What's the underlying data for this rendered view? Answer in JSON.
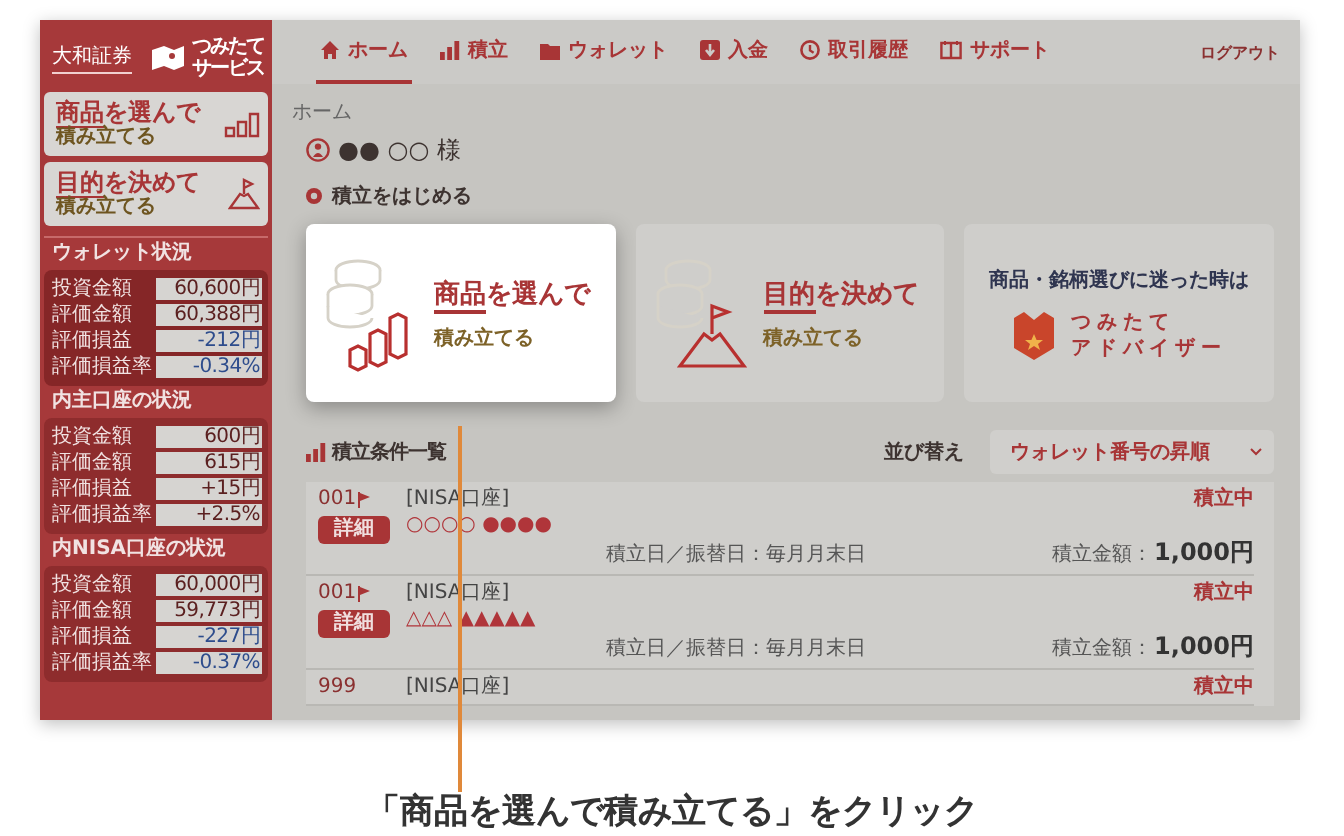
{
  "sidebar": {
    "brand": "大和証券",
    "service_logo": [
      "つみたて",
      "サービス"
    ],
    "shortcuts": [
      {
        "kind": "chart",
        "title_em": "商品",
        "title_rest": "を選んで",
        "subtitle": "積み立てる"
      },
      {
        "kind": "flag",
        "title_em": "目的",
        "title_rest": "を決めて",
        "subtitle": "積み立てる"
      }
    ],
    "summaries": [
      {
        "heading": "ウォレット状況",
        "rows": [
          {
            "label": "投資金額",
            "value": "60,600円",
            "negative": false
          },
          {
            "label": "評価金額",
            "value": "60,388円",
            "negative": false
          },
          {
            "label": "評価損益",
            "value": "-212円",
            "negative": true
          },
          {
            "label": "評価損益率",
            "value": "-0.34%",
            "negative": true
          }
        ]
      },
      {
        "heading": "内主口座の状況",
        "rows": [
          {
            "label": "投資金額",
            "value": "600円",
            "negative": false
          },
          {
            "label": "評価金額",
            "value": "615円",
            "negative": false
          },
          {
            "label": "評価損益",
            "value": "+15円",
            "negative": false
          },
          {
            "label": "評価損益率",
            "value": "+2.5%",
            "negative": false
          }
        ]
      },
      {
        "heading": "内NISA口座の状況",
        "rows": [
          {
            "label": "投資金額",
            "value": "60,000円",
            "negative": false
          },
          {
            "label": "評価金額",
            "value": "59,773円",
            "negative": false
          },
          {
            "label": "評価損益",
            "value": "-227円",
            "negative": true
          },
          {
            "label": "評価損益率",
            "value": "-0.37%",
            "negative": true
          }
        ]
      }
    ]
  },
  "nav": {
    "items": [
      {
        "label": "ホーム",
        "selected": true
      },
      {
        "label": "積立",
        "selected": false
      },
      {
        "label": "ウォレット",
        "selected": false
      },
      {
        "label": "入金",
        "selected": false
      },
      {
        "label": "取引履歴",
        "selected": false
      },
      {
        "label": "サポート",
        "selected": false
      }
    ],
    "logout": "ログアウト"
  },
  "breadcrumb": "ホーム",
  "user_name": "●● ○○ 様",
  "start": {
    "heading": "積立をはじめる",
    "cards": [
      {
        "kind": "product",
        "title_em": "商品",
        "title_rest": "を選んで",
        "subtitle": "積み立てる",
        "highlighted": true
      },
      {
        "kind": "goal",
        "title_em": "目的",
        "title_rest": "を決めて",
        "subtitle": "積み立てる",
        "highlighted": false
      },
      {
        "kind": "advisor",
        "lead": "商品・銘柄選びに迷った時は",
        "logo": [
          "つみたて",
          "アドバイザー"
        ],
        "highlighted": false
      }
    ]
  },
  "plans": {
    "heading": "積立条件一覧",
    "sort_label": "並び替え",
    "sort_value": "ウォレット番号の昇順",
    "rows": [
      {
        "number": "001",
        "flagged": true,
        "detail": "詳細",
        "account": "[NISA口座]",
        "symbols": "○○○○ ●●●●",
        "status": "積立中",
        "schedule": "積立日／振替日：毎月月末日",
        "amount_label": "積立金額：",
        "amount": "1,000円"
      },
      {
        "number": "001",
        "flagged": true,
        "detail": "詳細",
        "account": "[NISA口座]",
        "symbols": "△△△ ▲▲▲▲▲",
        "status": "積立中",
        "schedule": "積立日／振替日：毎月月末日",
        "amount_label": "積立金額：",
        "amount": "1,000円"
      },
      {
        "number": "999",
        "flagged": false,
        "account": "[NISA口座]",
        "status": "積立中"
      }
    ]
  },
  "caption": "「商品を選んで積み立てる」をクリック"
}
